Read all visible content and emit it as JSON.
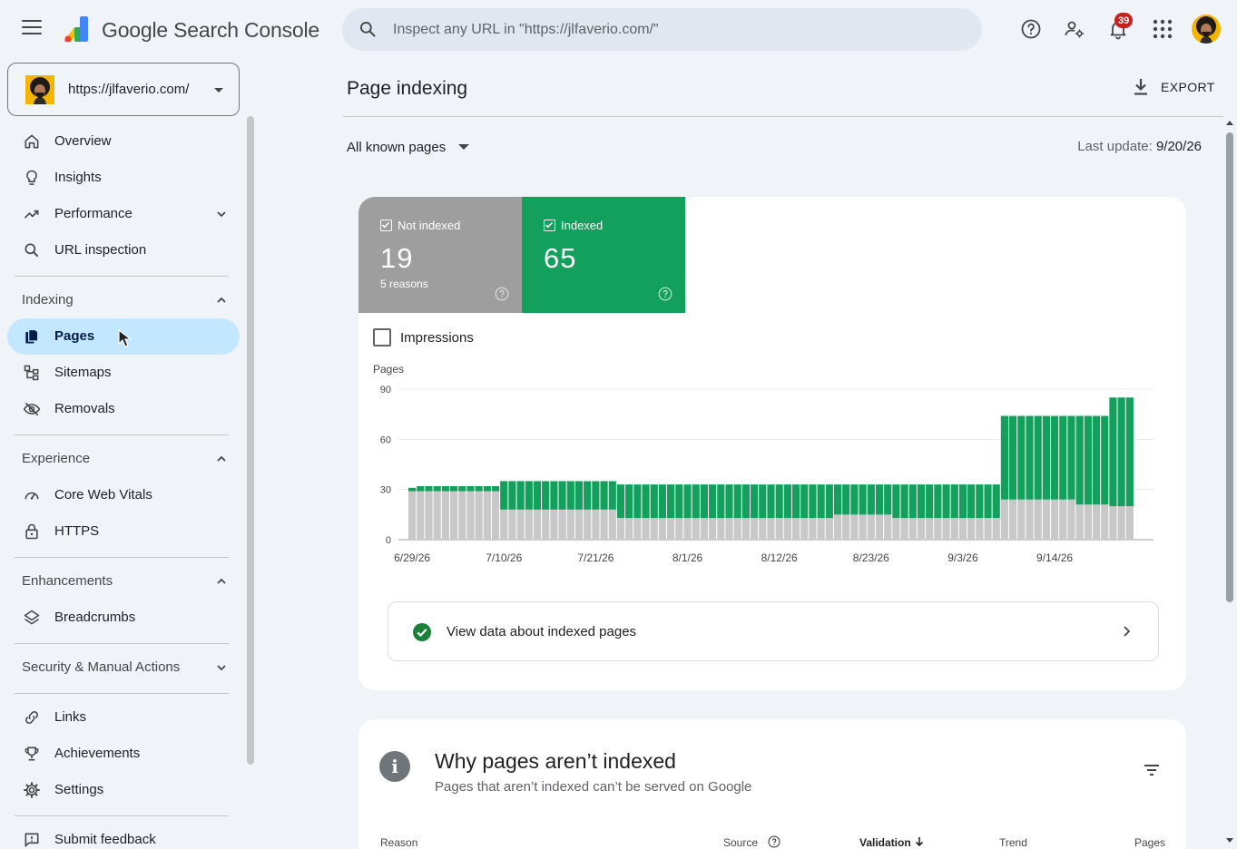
{
  "app": {
    "brand": "Google Search Console",
    "search_placeholder": "Inspect any URL in \"https://jlfaverio.com/\"",
    "notifications_count": "39"
  },
  "property": {
    "url": "https://jlfaverio.com/"
  },
  "sidebar": {
    "overview": "Overview",
    "insights": "Insights",
    "performance": "Performance",
    "url_inspection": "URL inspection",
    "indexing": "Indexing",
    "pages": "Pages",
    "sitemaps": "Sitemaps",
    "removals": "Removals",
    "experience": "Experience",
    "core_web_vitals": "Core Web Vitals",
    "https": "HTTPS",
    "enhancements": "Enhancements",
    "breadcrumbs": "Breadcrumbs",
    "security": "Security & Manual Actions",
    "links": "Links",
    "achievements": "Achievements",
    "settings": "Settings",
    "submit_feedback": "Submit feedback"
  },
  "main": {
    "title": "Page indexing",
    "export": "EXPORT",
    "filter": "All known pages",
    "last_update_label": "Last update:",
    "last_update_value": "9/20/26",
    "not_indexed": {
      "label": "Not indexed",
      "count": "19",
      "sub": "5 reasons"
    },
    "indexed": {
      "label": "Indexed",
      "count": "65"
    },
    "impressions_label": "Impressions",
    "view_data": "View data about indexed pages",
    "why_title": "Why pages aren’t indexed",
    "why_sub": "Pages that aren’t indexed can’t be served on Google",
    "table_headers": {
      "reason": "Reason",
      "source": "Source",
      "validation": "Validation",
      "trend": "Trend",
      "pages": "Pages"
    }
  },
  "colors": {
    "indexed": "#12a05c",
    "not_indexed": "#c8c8c8",
    "active_nav": "#c2e7ff"
  },
  "chart_data": {
    "type": "bar",
    "stacked": true,
    "ylabel": "Pages",
    "ylim": [
      0,
      90
    ],
    "yticks": [
      0,
      30,
      60,
      90
    ],
    "x_tick_labels": [
      "6/29/26",
      "7/10/26",
      "7/21/26",
      "8/1/26",
      "8/12/26",
      "8/23/26",
      "9/3/26",
      "9/14/26"
    ],
    "x_tick_index": [
      0,
      11,
      22,
      33,
      44,
      55,
      66,
      77
    ],
    "series": [
      {
        "name": "Not indexed",
        "values": [
          29,
          29,
          29,
          29,
          29,
          29,
          29,
          29,
          29,
          29,
          29,
          18,
          18,
          18,
          18,
          18,
          18,
          18,
          18,
          18,
          18,
          18,
          18,
          18,
          18,
          13,
          13,
          13,
          13,
          13,
          13,
          13,
          13,
          13,
          13,
          13,
          13,
          13,
          13,
          13,
          13,
          13,
          13,
          13,
          13,
          13,
          13,
          13,
          13,
          13,
          13,
          15,
          15,
          15,
          15,
          15,
          15,
          15,
          13,
          13,
          13,
          13,
          13,
          13,
          13,
          13,
          13,
          13,
          13,
          13,
          13,
          24,
          24,
          24,
          24,
          24,
          24,
          24,
          24,
          24,
          21,
          21,
          21,
          21,
          20,
          20,
          20
        ]
      },
      {
        "name": "Indexed",
        "values": [
          2,
          3,
          3,
          3,
          3,
          3,
          3,
          3,
          3,
          3,
          3,
          17,
          17,
          17,
          17,
          17,
          17,
          17,
          17,
          17,
          17,
          17,
          17,
          17,
          17,
          20,
          20,
          20,
          20,
          20,
          20,
          20,
          20,
          20,
          20,
          20,
          20,
          20,
          20,
          20,
          20,
          20,
          20,
          20,
          20,
          20,
          20,
          20,
          20,
          20,
          20,
          18,
          18,
          18,
          18,
          18,
          18,
          18,
          20,
          20,
          20,
          20,
          20,
          20,
          20,
          20,
          20,
          20,
          20,
          20,
          20,
          50,
          50,
          50,
          50,
          50,
          50,
          50,
          50,
          50,
          53,
          53,
          53,
          53,
          65,
          65,
          65
        ]
      }
    ]
  }
}
